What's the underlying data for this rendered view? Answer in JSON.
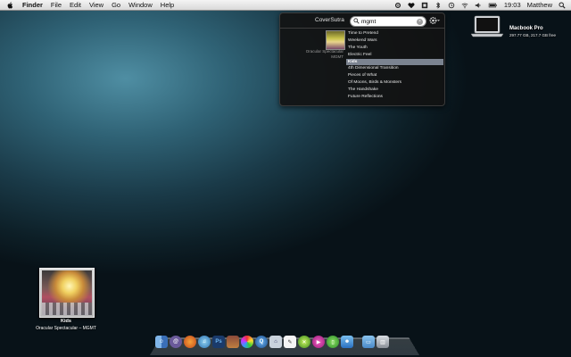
{
  "menubar": {
    "apple_icon": "apple-icon",
    "app_name": "Finder",
    "menus": [
      "File",
      "Edit",
      "View",
      "Go",
      "Window",
      "Help"
    ],
    "time": "19:03",
    "user": "Matthew"
  },
  "drive": {
    "name": "Macbook Pro",
    "space": "297.77 GB, 217.7 GB free"
  },
  "coversutra": {
    "title": "CoverSutra",
    "search_value": "mgmt",
    "album_line1": "Oracular Spectacular",
    "album_line2": "MGMT",
    "tracks": [
      "Time to Pretend",
      "Weekend Wars",
      "The Youth",
      "Electric Feel",
      "Kids",
      "4th Dimensional Transition",
      "Pieces of What",
      "Of Moons, Birds & Monsters",
      "The Handshake",
      "Future Reflections"
    ],
    "selected_index": 4
  },
  "now_playing": {
    "track": "Kids",
    "artist_album": "Oracular Spectacular – MGMT"
  },
  "colors": {
    "selection": "#7b8390",
    "panel_bg": "#121212"
  }
}
